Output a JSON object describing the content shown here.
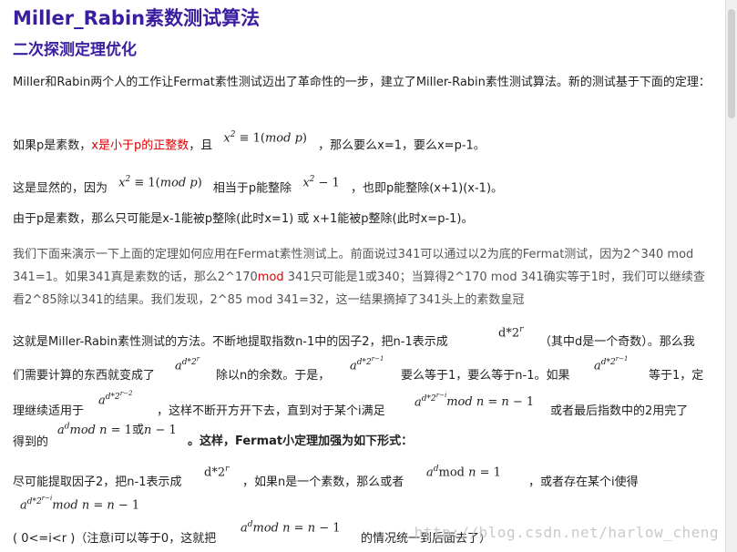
{
  "title": "Miller_Rabin素数测试算法",
  "subtitle": "二次探测定理优化",
  "p1": " Miller和Rabin两个人的工作让Fermat素性测试迈出了革命性的一步，建立了Miller-Rabin素性测试算法。新的测试基于下面的定理：",
  "p2": {
    "a": "如果p是素数，",
    "red": "x是小于p的正整数",
    "b": "，且",
    "c": "，那么要么x=1，要么x=p-1。"
  },
  "p3": {
    "a": "这是显然的，因为",
    "b": "相当于p能整除",
    "c": "，也即p能整除(x+1)(x-1)。"
  },
  "p4": "由于p是素数，那么只可能是x-1能被p整除(此时x=1) 或 x+1能被p整除(此时x=p-1)。",
  "p5": {
    "a": "我们下面来演示一下上面的定理如何应用在Fermat素性测试上。前面说过341可以通过以2为底的Fermat测试，因为2^340 mod 341=1。如果341真是素数的话，那么2^170",
    "red": "mod",
    "b": " 341只可能是1或340；当算得2^170 mod 341确实等于1时，我们可以继续查看2^85除以341的结果。我们发现，2^85 mod 341=32，这一结果摘掉了341头上的素数皇冠"
  },
  "p6": {
    "a": "这就是Miller-Rabin素性测试的方法。不断地提取指数n-1中的因子2，把n-1表示成",
    "b": "（其中d是一个奇数）。那么我们需要计算的东西就变成了",
    "c": "除以n的余数。于是，",
    "d": "要么等于1，要么等于n-1。如果",
    "e": "等于1，定理继续适用于",
    "f": "，这样不断开方开下去，直到对于某个i满足",
    "g": "或者最后指数中的2用完了得到的",
    "h": "。这样，Fermat小定理加强为如下形式："
  },
  "p7": {
    "a": "尽可能提取因子2，把n-1表示成",
    "b": "，如果n是一个素数，那么或者",
    "c": "，或者存在某个i使得"
  },
  "p8": {
    "a": "( 0<=i<r )（注意i可以等于0，这就把",
    "b": "的情况统一到后面去了）"
  },
  "watermark": "http://blog.csdn.net/harlow_cheng",
  "colors": {
    "heading": "#3b1ea0",
    "highlight": "#e00000",
    "grey_text": "#555555",
    "watermark": "#c9c9c9"
  }
}
